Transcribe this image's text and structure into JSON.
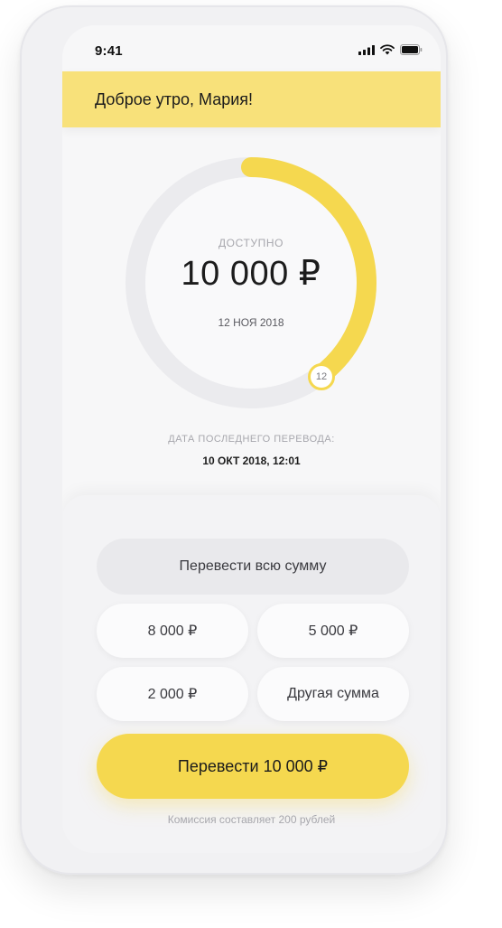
{
  "status_bar": {
    "time": "9:41",
    "icons": [
      "signal-icon",
      "wifi-icon",
      "battery-icon"
    ]
  },
  "header": {
    "greeting": "Доброе утро, Мария!"
  },
  "balance": {
    "label": "ДОСТУПНО",
    "amount": "10 000 ₽",
    "date": "12 НОЯ 2018",
    "day_badge": "12",
    "progress_fraction": 0.4
  },
  "last_transfer": {
    "label": "ДАТА ПОСЛЕДНЕГО ПЕРЕВОДА:",
    "value": "10 ОКТ 2018, 12:01"
  },
  "actions": {
    "transfer_all": "Перевести всю сумму",
    "amounts": [
      "8 000 ₽",
      "5 000 ₽",
      "2 000 ₽"
    ],
    "other_amount": "Другая сумма",
    "transfer_button": "Перевести 10 000 ₽",
    "commission": "Комиссия составляет 200 рублей"
  },
  "colors": {
    "accent": "#f5d84f",
    "header_bg": "#f8e17a",
    "ring_track": "#ebebee"
  }
}
